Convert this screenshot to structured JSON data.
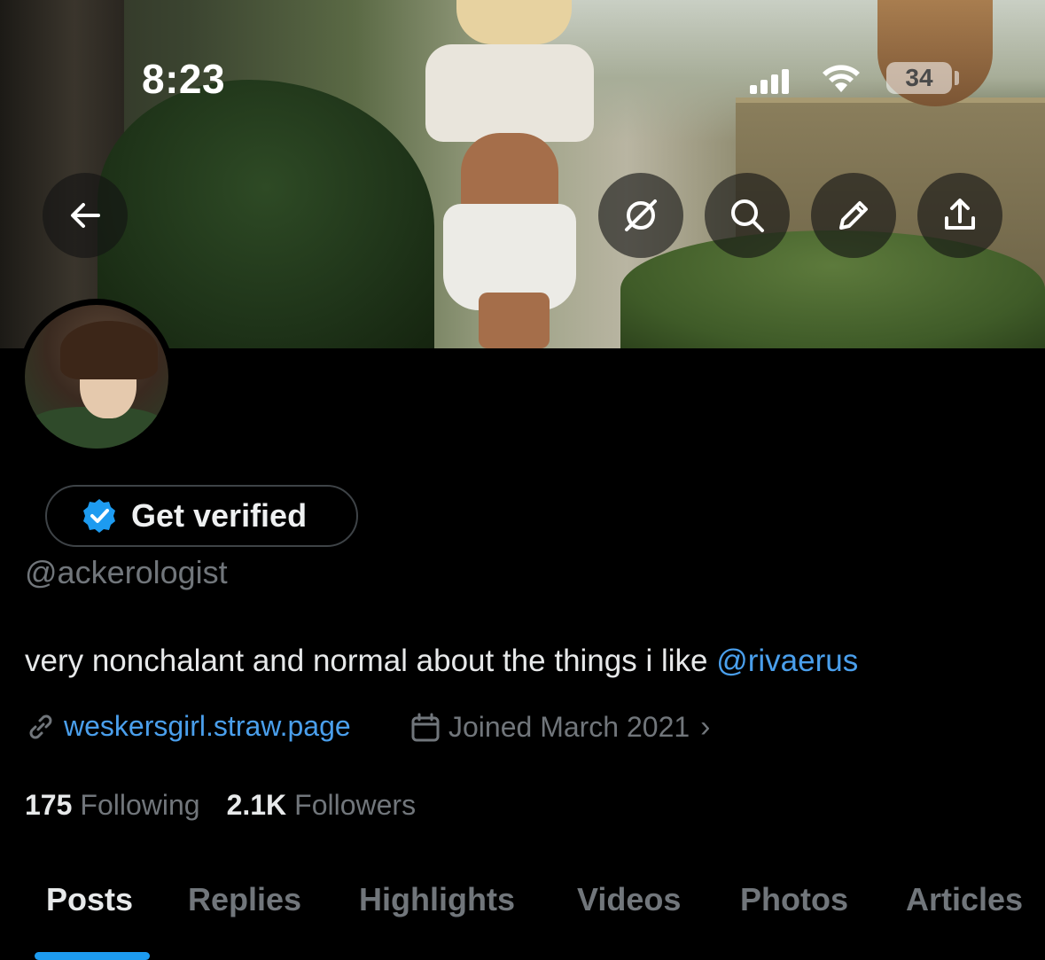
{
  "status_bar": {
    "time": "8:23",
    "battery": "34"
  },
  "header": {
    "back_icon": "arrow-left-icon",
    "grok_icon": "grok-icon",
    "search_icon": "search-icon",
    "edit_icon": "pencil-icon",
    "share_icon": "share-icon"
  },
  "profile": {
    "get_verified_label": "Get verified",
    "handle": "@ackerologist",
    "bio_text": "very nonchalant and normal about the things i like ",
    "bio_mention": "@rivaerus",
    "link": "weskersgirl.straw.page",
    "joined": "Joined March 2021",
    "following_count": "175",
    "following_label": "Following",
    "followers_count": "2.1K",
    "followers_label": "Followers"
  },
  "tabs": [
    {
      "label": "Posts"
    },
    {
      "label": "Replies"
    },
    {
      "label": "Highlights"
    },
    {
      "label": "Videos"
    },
    {
      "label": "Photos"
    },
    {
      "label": "Articles"
    }
  ],
  "colors": {
    "accent": "#1d9bf0",
    "link": "#4a9fec",
    "muted": "#71767b",
    "background": "#000000"
  }
}
